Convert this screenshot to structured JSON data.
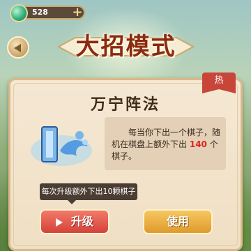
{
  "currency": {
    "amount": "528",
    "icon": "jade-icon",
    "plus": "+"
  },
  "title": {
    "text": "大招模式"
  },
  "hot_tag": "热",
  "skill": {
    "name": "万宁阵法",
    "desc_before": "每当你下出一个棋子，随机在棋盘上额外下出",
    "desc_num": "140",
    "desc_after": "个棋子。"
  },
  "tooltip": "每次升级额外下出10颗棋子",
  "buttons": {
    "upgrade": "升级",
    "use": "使用"
  },
  "colors": {
    "accent": "#d4423a",
    "gold": "#df9a2c",
    "desc_highlight": "#d9261e"
  }
}
